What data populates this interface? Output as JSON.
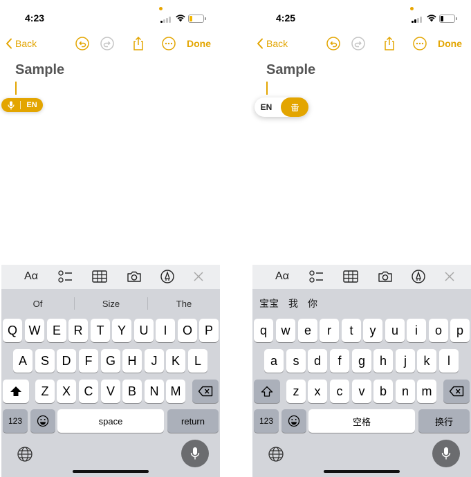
{
  "colors": {
    "accent": "#e3a500",
    "keyboard_bg": "#d3d5da",
    "fn_key": "#abb0ba"
  },
  "left": {
    "status": {
      "time": "4:23",
      "battery_color": "#f2b600"
    },
    "toolbar": {
      "back": "Back",
      "done": "Done"
    },
    "note": {
      "title": "Sample"
    },
    "dictation": {
      "lang": "EN",
      "icon": "mic-icon"
    },
    "accessory": {
      "format": "Aα"
    },
    "suggestions": [
      "Of",
      "Size",
      "The"
    ],
    "rows": [
      [
        "Q",
        "W",
        "E",
        "R",
        "T",
        "Y",
        "U",
        "I",
        "O",
        "P"
      ],
      [
        "A",
        "S",
        "D",
        "F",
        "G",
        "H",
        "J",
        "K",
        "L"
      ],
      [
        "Z",
        "X",
        "C",
        "V",
        "B",
        "N",
        "M"
      ]
    ],
    "keys": {
      "numbers": "123",
      "space": "space",
      "return": "return"
    }
  },
  "right": {
    "status": {
      "time": "4:25",
      "battery_color": "#000000"
    },
    "toolbar": {
      "back": "Back",
      "done": "Done"
    },
    "note": {
      "title": "Sample"
    },
    "dictation": {
      "lang": "EN",
      "icon": "pinyin-input-icon"
    },
    "accessory": {
      "format": "Aα"
    },
    "suggestions": [
      "宝宝",
      "我",
      "你"
    ],
    "rows": [
      [
        "q",
        "w",
        "e",
        "r",
        "t",
        "y",
        "u",
        "i",
        "o",
        "p"
      ],
      [
        "a",
        "s",
        "d",
        "f",
        "g",
        "h",
        "j",
        "k",
        "l"
      ],
      [
        "z",
        "x",
        "c",
        "v",
        "b",
        "n",
        "m"
      ]
    ],
    "keys": {
      "numbers": "123",
      "space": "空格",
      "return": "换行"
    }
  }
}
